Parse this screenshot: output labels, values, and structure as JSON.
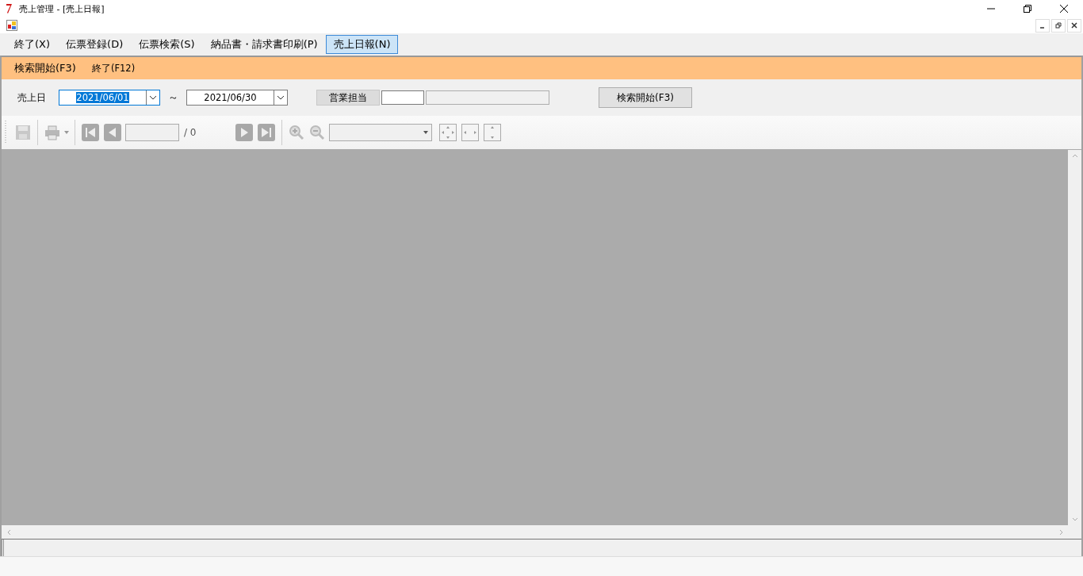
{
  "window": {
    "title": "売上管理 - [売上日報]"
  },
  "menu": [
    {
      "label": "終了(X)",
      "selected": false
    },
    {
      "label": "伝票登録(D)",
      "selected": false
    },
    {
      "label": "伝票検索(S)",
      "selected": false
    },
    {
      "label": "納品書・請求書印刷(P)",
      "selected": false
    },
    {
      "label": "売上日報(N)",
      "selected": true
    }
  ],
  "command_bar": [
    {
      "label": "検索開始(F3)"
    },
    {
      "label": "終了(F12)"
    }
  ],
  "form": {
    "date_label": "売上日",
    "date_from": {
      "value": "2021/06/01",
      "focused": true
    },
    "range_sign": "～",
    "date_to": {
      "value": "2021/06/30",
      "focused": false
    },
    "staff_label": "営業担当",
    "search_button": "検索開始(F3)"
  },
  "viewer_toolbar": {
    "page_total": "/ 0"
  }
}
